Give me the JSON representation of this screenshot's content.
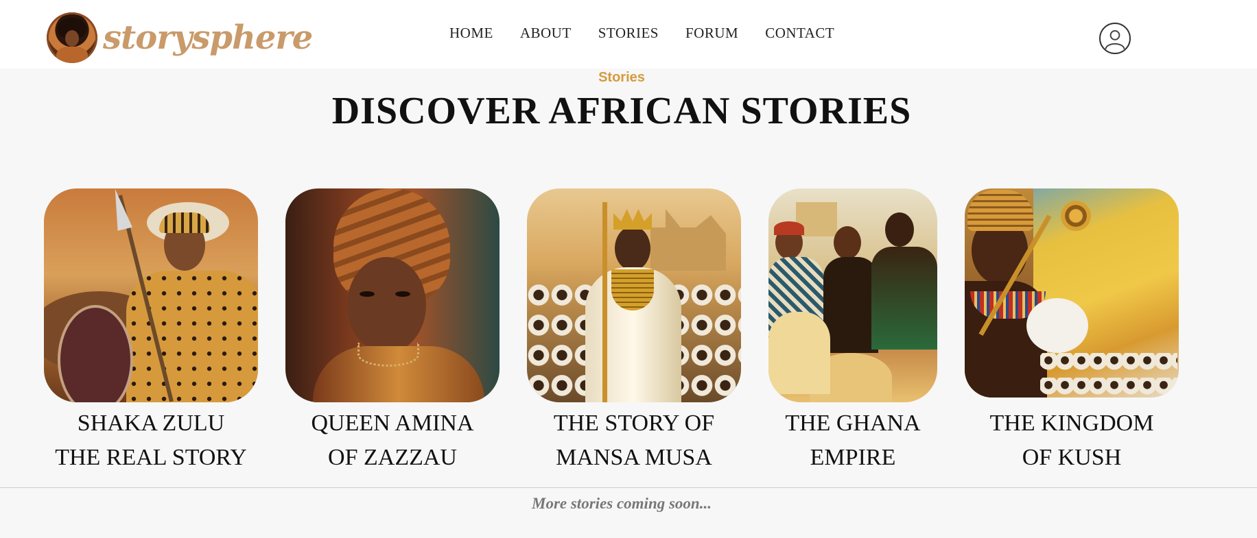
{
  "brand": {
    "name": "storysphere"
  },
  "nav": {
    "items": [
      "HOME",
      "ABOUT",
      "STORIES",
      "FORUM",
      "CONTACT"
    ],
    "user_icon": "user-circle-icon"
  },
  "section": {
    "eyebrow": "Stories",
    "title": "DISCOVER AFRICAN STORIES"
  },
  "stories": [
    {
      "line1": "SHAKA ZULU",
      "line2": "THE REAL STORY",
      "image": "shaka-zulu-warrior-image"
    },
    {
      "line1": "QUEEN AMINA",
      "line2": "OF ZAZZAU",
      "image": "queen-amina-portrait-image"
    },
    {
      "line1": "THE STORY OF",
      "line2": "MANSA MUSA",
      "image": "mansa-musa-king-image"
    },
    {
      "line1": "THE GHANA",
      "line2": "EMPIRE",
      "image": "ghana-empire-market-image"
    },
    {
      "line1": "THE KINGDOM",
      "line2": "OF KUSH",
      "image": "kingdom-of-kush-map-image"
    }
  ],
  "footer": {
    "text": "More stories coming soon..."
  },
  "colors": {
    "accent": "#d69a3c",
    "logo": "#c99a6a",
    "muted": "#777777"
  }
}
